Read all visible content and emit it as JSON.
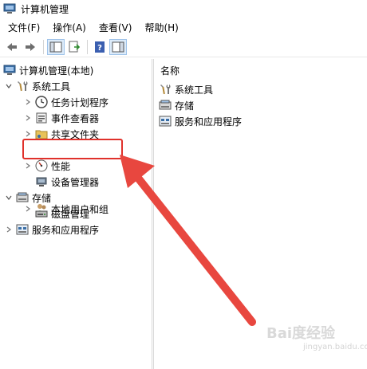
{
  "window": {
    "title": "计算机管理"
  },
  "menu": [
    "文件(F)",
    "操作(A)",
    "查看(V)",
    "帮助(H)"
  ],
  "tree": {
    "root": "计算机管理(本地)",
    "system_tools": "系统工具",
    "task_scheduler": "任务计划程序",
    "event_viewer": "事件查看器",
    "shared_folders": "共享文件夹",
    "local_users": "本地用户和组",
    "performance": "性能",
    "device_manager": "设备管理器",
    "storage": "存储",
    "disk_management": "磁盘管理",
    "services_apps": "服务和应用程序"
  },
  "list": {
    "header": "名称",
    "items": [
      "系统工具",
      "存储",
      "服务和应用程序"
    ]
  },
  "watermark": {
    "text": "Bai度经验",
    "sub": "jingyan.baidu.com"
  },
  "colors": {
    "highlight": "#e0312b",
    "arrow": "#e8473f"
  }
}
